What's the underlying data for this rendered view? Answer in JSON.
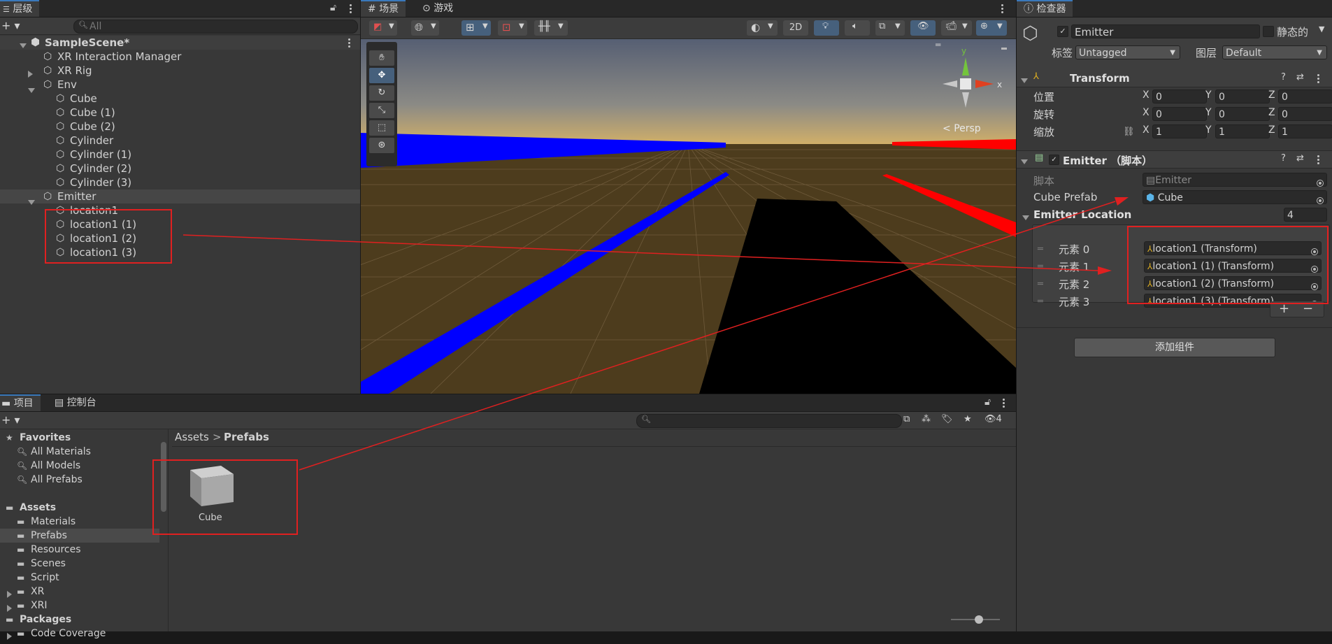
{
  "hierarchy": {
    "tab": "层级",
    "search_placeholder": "All",
    "scene": "SampleScene*",
    "items": [
      {
        "label": "XR Interaction Manager",
        "indent": 1,
        "arrow": "none"
      },
      {
        "label": "XR Rig",
        "indent": 1,
        "arrow": "right"
      },
      {
        "label": "Env",
        "indent": 1,
        "arrow": "down"
      },
      {
        "label": "Cube",
        "indent": 2,
        "arrow": "none"
      },
      {
        "label": "Cube (1)",
        "indent": 2,
        "arrow": "none"
      },
      {
        "label": "Cube (2)",
        "indent": 2,
        "arrow": "none"
      },
      {
        "label": "Cylinder",
        "indent": 2,
        "arrow": "none"
      },
      {
        "label": "Cylinder (1)",
        "indent": 2,
        "arrow": "none"
      },
      {
        "label": "Cylinder (2)",
        "indent": 2,
        "arrow": "none"
      },
      {
        "label": "Cylinder (3)",
        "indent": 2,
        "arrow": "none"
      },
      {
        "label": "Emitter",
        "indent": 1,
        "arrow": "down",
        "selected": true
      },
      {
        "label": "location1",
        "indent": 2,
        "arrow": "none"
      },
      {
        "label": "location1 (1)",
        "indent": 2,
        "arrow": "none"
      },
      {
        "label": "location1 (2)",
        "indent": 2,
        "arrow": "none"
      },
      {
        "label": "location1 (3)",
        "indent": 2,
        "arrow": "none"
      }
    ]
  },
  "scene_view": {
    "tab_scene": "场景",
    "tab_game": "游戏",
    "btn_2d": "2D",
    "persp": "Persp",
    "gizmo_y": "y",
    "gizmo_x": "x"
  },
  "inspector": {
    "tab": "检查器",
    "object_name": "Emitter",
    "static_label": "静态的",
    "tag_label": "标签",
    "tag_value": "Untagged",
    "layer_label": "图层",
    "layer_value": "Default",
    "transform": {
      "title": "Transform",
      "position_label": "位置",
      "rotation_label": "旋转",
      "scale_label": "缩放",
      "axis_x": "X",
      "axis_y": "Y",
      "axis_z": "Z",
      "position": [
        "0",
        "0",
        "0"
      ],
      "rotation": [
        "0",
        "0",
        "0"
      ],
      "scale": [
        "1",
        "1",
        "1"
      ]
    },
    "script_component": {
      "title": "Emitter （脚本）",
      "script_label": "脚本",
      "script_value": "Emitter",
      "cube_prefab_label": "Cube Prefab",
      "cube_prefab_value": "Cube",
      "list_label": "Emitter Location",
      "list_count": "4",
      "elements": [
        {
          "label": "元素 0",
          "value": "location1 (Transform)"
        },
        {
          "label": "元素 1",
          "value": "location1 (1) (Transform)"
        },
        {
          "label": "元素 2",
          "value": "location1 (2) (Transform)"
        },
        {
          "label": "元素 3",
          "value": "location1 (3) (Transform)"
        }
      ],
      "plus": "+",
      "minus": "−"
    },
    "add_component": "添加组件"
  },
  "project": {
    "tab_project": "项目",
    "tab_console": "控制台",
    "hidden_count": "4",
    "favorites": "Favorites",
    "fav_items": [
      "All Materials",
      "All Models",
      "All Prefabs"
    ],
    "assets": "Assets",
    "asset_folders": [
      "Materials",
      "Prefabs",
      "Resources",
      "Scenes",
      "Script"
    ],
    "collapsed_folders": [
      "XR",
      "XRI"
    ],
    "packages": "Packages",
    "packages_child": "Code Coverage",
    "breadcrumb_root": "Assets",
    "breadcrumb_current": "Prefabs",
    "asset_item": "Cube"
  },
  "colors": {
    "blue_line": "#0000ff",
    "red_line": "#ff0000",
    "annotation": "#e02020",
    "selection": "#2c5d87"
  }
}
